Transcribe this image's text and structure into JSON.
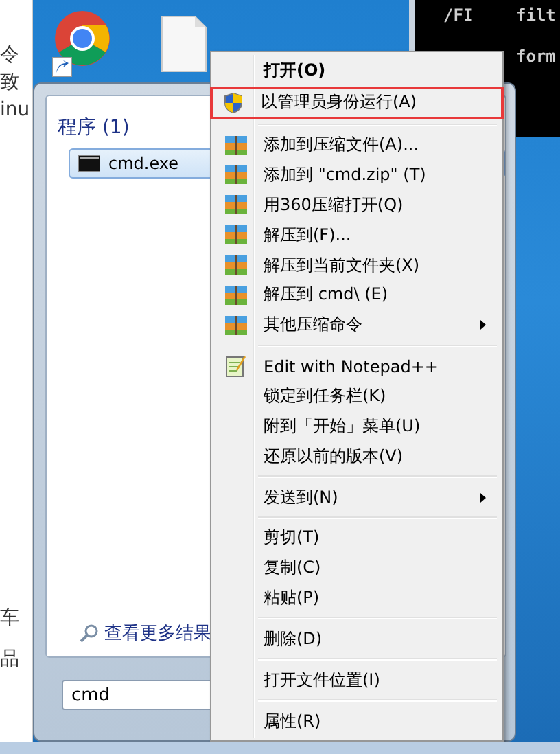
{
  "left_page": {
    "fragments": [
      "令",
      "致",
      "inu",
      "车",
      "品"
    ]
  },
  "terminal": {
    "lines": [
      {
        "flag": "/FI",
        "text": "filt"
      },
      {
        "text": "form"
      }
    ]
  },
  "desktop_icons": [
    {
      "kind": "chrome"
    },
    {
      "kind": "file"
    }
  ],
  "start_menu": {
    "section": "程序 (1)",
    "results": [
      {
        "label": "cmd.exe",
        "selected": true
      }
    ],
    "more_results": "查看更多结果",
    "search": {
      "value": "cmd"
    }
  },
  "context_menu": {
    "items": [
      {
        "kind": "plain",
        "label": "打开(O)",
        "default": true,
        "submenu": false,
        "highlighted": false
      },
      {
        "kind": "shield",
        "label": "以管理员身份运行(A)",
        "default": false,
        "submenu": false,
        "highlighted": true
      },
      {
        "kind": "separator"
      },
      {
        "kind": "archive",
        "label": "添加到压缩文件(A)...",
        "default": false,
        "submenu": false,
        "highlighted": false
      },
      {
        "kind": "archive",
        "label": "添加到 \"cmd.zip\" (T)",
        "default": false,
        "submenu": false,
        "highlighted": false
      },
      {
        "kind": "archive",
        "label": "用360压缩打开(Q)",
        "default": false,
        "submenu": false,
        "highlighted": false
      },
      {
        "kind": "archive",
        "label": "解压到(F)...",
        "default": false,
        "submenu": false,
        "highlighted": false
      },
      {
        "kind": "archive",
        "label": "解压到当前文件夹(X)",
        "default": false,
        "submenu": false,
        "highlighted": false
      },
      {
        "kind": "archive",
        "label": "解压到 cmd\\ (E)",
        "default": false,
        "submenu": false,
        "highlighted": false
      },
      {
        "kind": "archive",
        "label": "其他压缩命令",
        "default": false,
        "submenu": true,
        "highlighted": false
      },
      {
        "kind": "separator"
      },
      {
        "kind": "notepad",
        "label": "Edit with Notepad++",
        "default": false,
        "submenu": false,
        "highlighted": false
      },
      {
        "kind": "plain",
        "label": "锁定到任务栏(K)",
        "default": false,
        "submenu": false,
        "highlighted": false
      },
      {
        "kind": "plain",
        "label": "附到「开始」菜单(U)",
        "default": false,
        "submenu": false,
        "highlighted": false
      },
      {
        "kind": "plain",
        "label": "还原以前的版本(V)",
        "default": false,
        "submenu": false,
        "highlighted": false
      },
      {
        "kind": "separator"
      },
      {
        "kind": "plain",
        "label": "发送到(N)",
        "default": false,
        "submenu": true,
        "highlighted": false
      },
      {
        "kind": "separator"
      },
      {
        "kind": "plain",
        "label": "剪切(T)",
        "default": false,
        "submenu": false,
        "highlighted": false
      },
      {
        "kind": "plain",
        "label": "复制(C)",
        "default": false,
        "submenu": false,
        "highlighted": false
      },
      {
        "kind": "plain",
        "label": "粘贴(P)",
        "default": false,
        "submenu": false,
        "highlighted": false
      },
      {
        "kind": "separator"
      },
      {
        "kind": "plain",
        "label": "删除(D)",
        "default": false,
        "submenu": false,
        "highlighted": false
      },
      {
        "kind": "separator"
      },
      {
        "kind": "plain",
        "label": "打开文件位置(I)",
        "default": false,
        "submenu": false,
        "highlighted": false
      },
      {
        "kind": "separator"
      },
      {
        "kind": "plain",
        "label": "属性(R)",
        "default": false,
        "submenu": false,
        "highlighted": false
      }
    ]
  }
}
